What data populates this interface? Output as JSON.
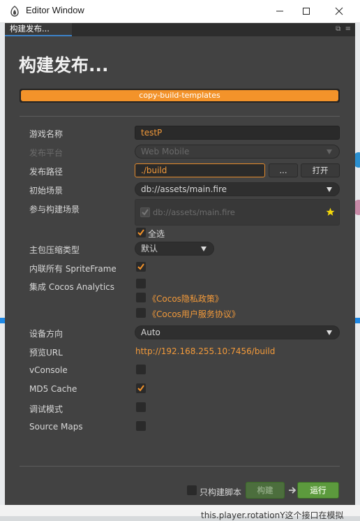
{
  "window": {
    "title": "Editor Window"
  },
  "tab": {
    "label": "构建发布..."
  },
  "header": {
    "title": "构建发布..."
  },
  "progress": {
    "text": "copy-build-templates",
    "value": 1.0
  },
  "form": {
    "game_name": {
      "label": "游戏名称",
      "value": "testP"
    },
    "platform": {
      "label": "发布平台",
      "value": "Web Mobile"
    },
    "build_path": {
      "label": "发布路径",
      "value": "./build",
      "browse": "...",
      "open": "打开"
    },
    "start_scene": {
      "label": "初始场景",
      "value": "db://assets/main.fire"
    },
    "build_scenes": {
      "label": "参与构建场景",
      "scene": "db://assets/main.fire",
      "select_all": "全选"
    },
    "compression": {
      "label": "主包压缩类型",
      "value": "默认"
    },
    "inline_sprite": {
      "label": "内联所有 SpriteFrame",
      "checked": true
    },
    "analytics": {
      "label": "集成 Cocos Analytics",
      "checked": false,
      "privacy_link": "《Cocos隐私政策》",
      "terms_link": "《Cocos用户服务协议》"
    },
    "orientation": {
      "label": "设备方向",
      "value": "Auto"
    },
    "preview_url": {
      "label": "预览URL",
      "value": "http://192.168.255.10:7456/build"
    },
    "vconsole": {
      "label": "vConsole",
      "checked": false
    },
    "md5": {
      "label": "MD5 Cache",
      "checked": true
    },
    "debug": {
      "label": "调试模式",
      "checked": false
    },
    "source_maps": {
      "label": "Source Maps",
      "checked": false
    }
  },
  "footer": {
    "script_only": "只构建脚本",
    "build": "构建",
    "run": "运行"
  },
  "background": {
    "line1": "this.player.rotationY这个接口在模拟"
  },
  "colors": {
    "accent": "#f3932a",
    "panel": "#424242",
    "run": "#5c9a3d"
  }
}
